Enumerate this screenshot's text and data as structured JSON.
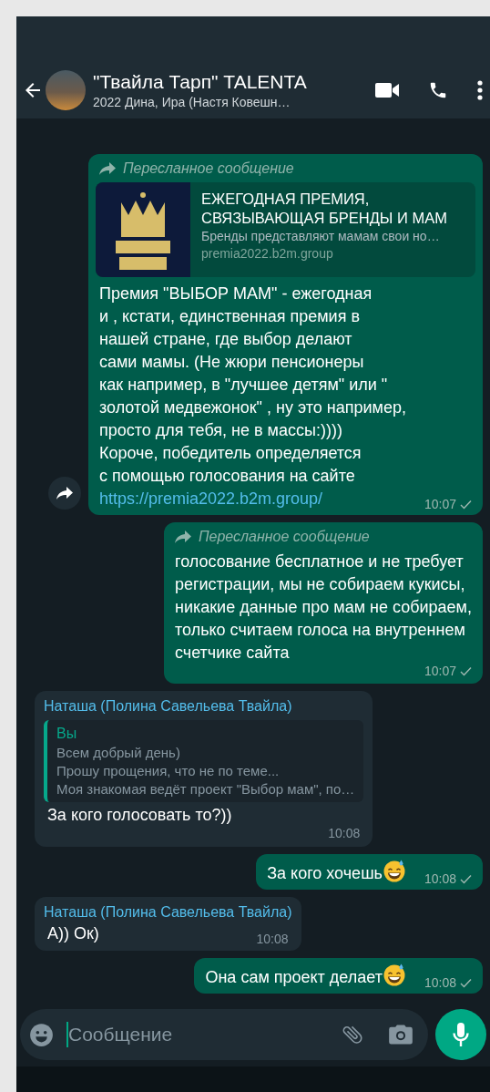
{
  "header": {
    "title": "\"Твайла Тарп\" TALENTA",
    "subtitle": "2022 Дина, Ира (Настя Ковешн…"
  },
  "messages": [
    {
      "kind": "outgoing",
      "forwarded": true,
      "forwarded_label": "Пересланное сообщение",
      "link_preview": {
        "title": "ЕЖЕГОДНАЯ ПРЕМИЯ,\nСВЯЗЫВАЮЩАЯ БРЕНДЫ И МАМ",
        "description": "Бренды представляют мамам свои но…",
        "domain": "premia2022.b2m.group"
      },
      "text": "Премия \"ВЫБОР МАМ\" - ежегодная\nи , кстати, единственная премия в\nнашей стране, где выбор делают\nсами мамы. (Не жюри пенсионеры\nкак например, в \"лучшее детям\" или \"\nзолотой медвежонок\" , ну это например,\nпросто для тебя, не в массы:))))\nКороче, победитель определяется\nс помощью голосования на сайте",
      "link": "https://premia2022.b2m.group/",
      "time": "10:07",
      "share_button": true,
      "trailing_emoji": false
    },
    {
      "kind": "outgoing",
      "forwarded": true,
      "forwarded_label": "Пересланное сообщение",
      "text": "голосование бесплатное и не требует\nрегистрации, мы не собираем кукисы,\nникакие данные про мам не собираем,\nтолько считаем голоса на внутреннем\nсчетчике сайта",
      "time": "10:07",
      "share_button": false,
      "trailing_emoji": false
    },
    {
      "kind": "incoming",
      "forwarded": false,
      "sender": "Наташа (Полина Савельева Твайла)",
      "reply": {
        "author": "Вы",
        "text": "Всем добрый день)\nПрошу прощения, что не по теме...\nМоя знакомая ведёт проект \"Выбор мам\", по…"
      },
      "text": "За кого голосовать то?))",
      "time": "10:08",
      "share_button": false,
      "trailing_emoji": false
    },
    {
      "kind": "outgoing",
      "forwarded": false,
      "text": "За кого хочешь",
      "time": "10:08",
      "share_button": false,
      "trailing_emoji": true
    },
    {
      "kind": "incoming",
      "forwarded": false,
      "sender": "Наташа (Полина Савельева Твайла)",
      "text": "А)) Ок)",
      "time": "10:08",
      "share_button": false,
      "trailing_emoji": false
    },
    {
      "kind": "outgoing",
      "forwarded": false,
      "text": "Она сам проект делает",
      "time": "10:08",
      "share_button": false,
      "trailing_emoji": true
    }
  ],
  "composer": {
    "placeholder": "Сообщение"
  }
}
